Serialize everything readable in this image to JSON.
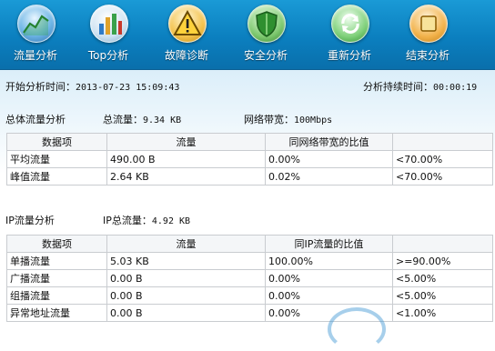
{
  "toolbar": {
    "buttons": [
      {
        "label": "流量分析",
        "icon": "traffic-gauge-icon"
      },
      {
        "label": "Top分析",
        "icon": "bar-chart-icon"
      },
      {
        "label": "故障诊断",
        "icon": "warning-icon"
      },
      {
        "label": "安全分析",
        "icon": "shield-icon"
      },
      {
        "label": "重新分析",
        "icon": "refresh-icon"
      },
      {
        "label": "结束分析",
        "icon": "stop-icon"
      }
    ]
  },
  "header": {
    "start_time_label": "开始分析时间：",
    "start_time_value": "2013-07-23 15:09:43",
    "duration_label": "分析持续时间：",
    "duration_value": "00:00:19"
  },
  "total_section": {
    "title": "总体流量分析",
    "total_label": "总流量：",
    "total_value": "9.34 KB",
    "bandwidth_label": "网络带宽：",
    "bandwidth_value": "100Mbps",
    "columns": [
      "数据项",
      "流量",
      "同网络带宽的比值",
      ""
    ],
    "rows": [
      [
        "平均流量",
        "490.00 B",
        "0.00%",
        "<70.00%"
      ],
      [
        "峰值流量",
        "2.64 KB",
        "0.02%",
        "<70.00%"
      ]
    ]
  },
  "ip_section": {
    "title": "IP流量分析",
    "total_label": "IP总流量：",
    "total_value": "4.92 KB",
    "columns": [
      "数据项",
      "流量",
      "同IP流量的比值",
      ""
    ],
    "rows": [
      [
        "单播流量",
        "5.03 KB",
        "100.00%",
        ">=90.00%"
      ],
      [
        "广播流量",
        "0.00 B",
        "0.00%",
        "<5.00%"
      ],
      [
        "组播流量",
        "0.00 B",
        "0.00%",
        "<5.00%"
      ],
      [
        "异常地址流量",
        "0.00 B",
        "0.00%",
        "<1.00%"
      ]
    ]
  },
  "colors": {
    "toolbar": "#0b7fbf",
    "grid_border": "#c9ccd0"
  }
}
